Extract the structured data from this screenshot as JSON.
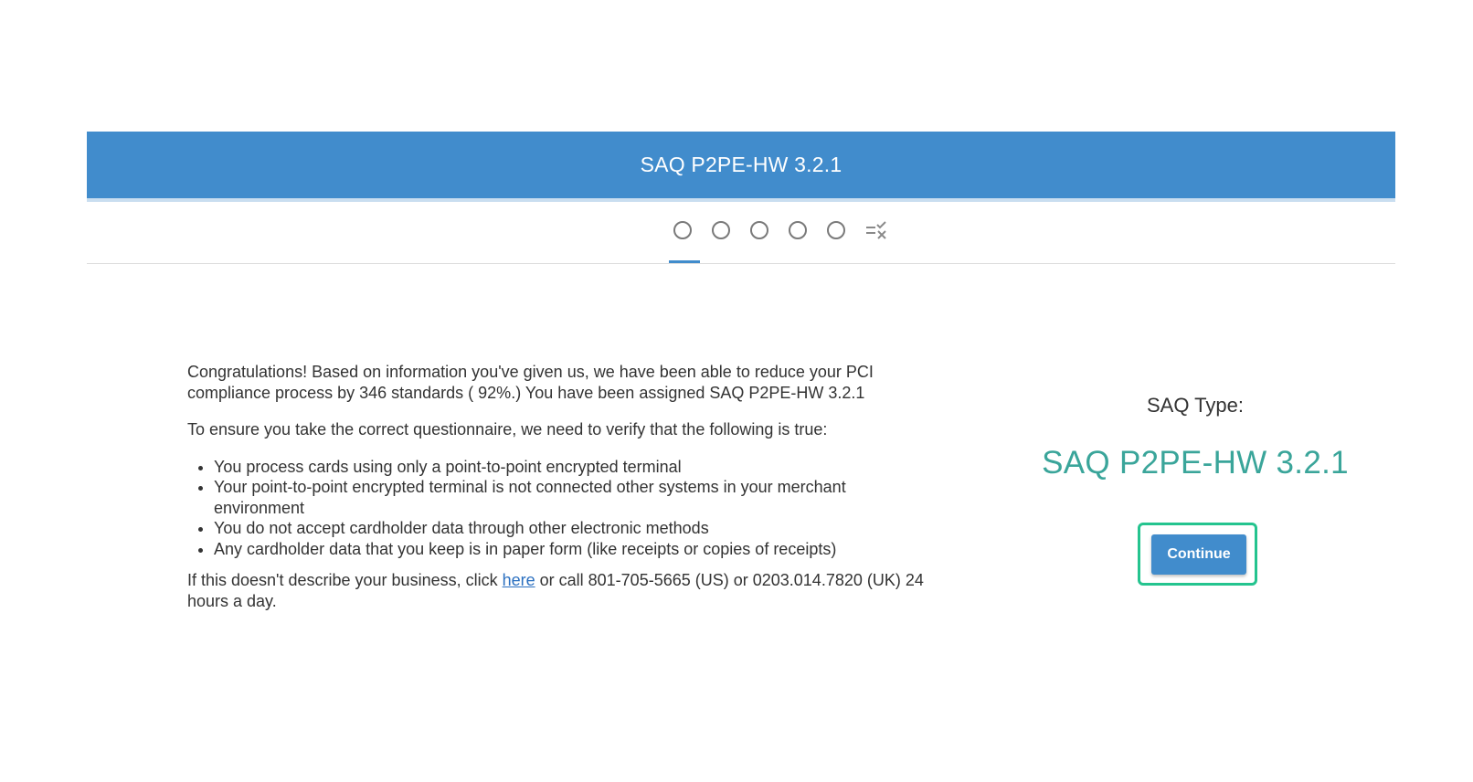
{
  "header": {
    "title": "SAQ P2PE-HW 3.2.1"
  },
  "stepper": {
    "step_count": 5,
    "final_step_icon": "checklist-icon",
    "active_step": 1
  },
  "main": {
    "intro": "Congratulations! Based on information you've given us, we have been able to reduce your PCI compliance process by 346 standards ( 92%.) You have been assigned SAQ P2PE-HW 3.2.1",
    "verify_text": "To ensure you take the correct questionnaire, we need to verify that the following is true:",
    "conditions": [
      "You process cards using only a point-to-point encrypted terminal",
      "Your point-to-point encrypted terminal is not connected other systems in your merchant environment",
      "You do not accept cardholder data through other electronic methods",
      "Any cardholder data that you keep is in paper form (like receipts or copies of receipts)"
    ],
    "help_prefix": "If this doesn't describe your business, click ",
    "help_link": "here",
    "help_suffix": " or call 801-705-5665 (US) or 0203.014.7820 (UK) 24 hours a day."
  },
  "side_panel": {
    "type_label": "SAQ Type:",
    "type_value": "SAQ P2PE-HW 3.2.1",
    "continue_label": "Continue"
  },
  "colors": {
    "header_blue": "#418ccc",
    "saq_type_teal": "#3aa59a",
    "highlight_green": "#25c48f",
    "link_blue": "#2a6fc0"
  }
}
